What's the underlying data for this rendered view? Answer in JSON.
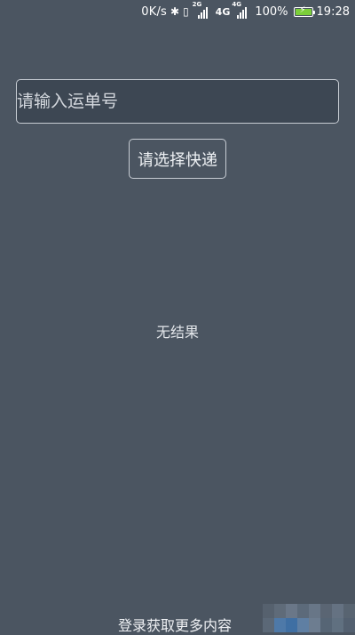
{
  "status_bar": {
    "net_speed": "0K/s",
    "signal_1_label": "2G",
    "net_type": "4G",
    "signal_2_label": "4G",
    "battery_percent": "100%",
    "time": "19:28"
  },
  "search": {
    "placeholder": "请输入运单号",
    "value": ""
  },
  "courier_button": {
    "label": "请选择快递"
  },
  "result": {
    "text": "无结果"
  },
  "footer": {
    "login_prompt": "登录获取更多内容"
  },
  "colors": {
    "background": "#4b5561",
    "input_background": "#3d4753",
    "border": "#c7ccd3",
    "battery": "#7ccf3a"
  }
}
